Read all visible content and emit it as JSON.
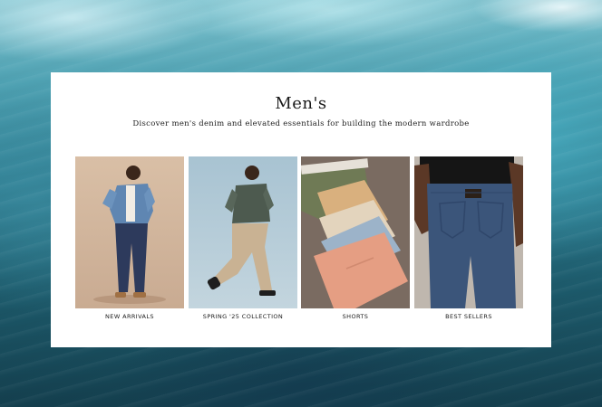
{
  "section": {
    "title": "Men's",
    "subtitle": "Discover men's denim and elevated essentials for building the modern wardrobe"
  },
  "tiles": [
    {
      "label": "NEW ARRIVALS",
      "image": "man-in-denim-jacket-photo"
    },
    {
      "label": "SPRING '25 COLLECTION",
      "image": "man-in-cargo-pants-photo"
    },
    {
      "label": "SHORTS",
      "image": "stack-of-shorts-photo"
    },
    {
      "label": "BEST SELLERS",
      "image": "jeans-back-pocket-photo"
    }
  ],
  "colors": {
    "panel": "#ffffff",
    "text": "#1a1a1a",
    "ocean_dark": "#143f4e",
    "ocean_light": "#7fc3cf"
  }
}
